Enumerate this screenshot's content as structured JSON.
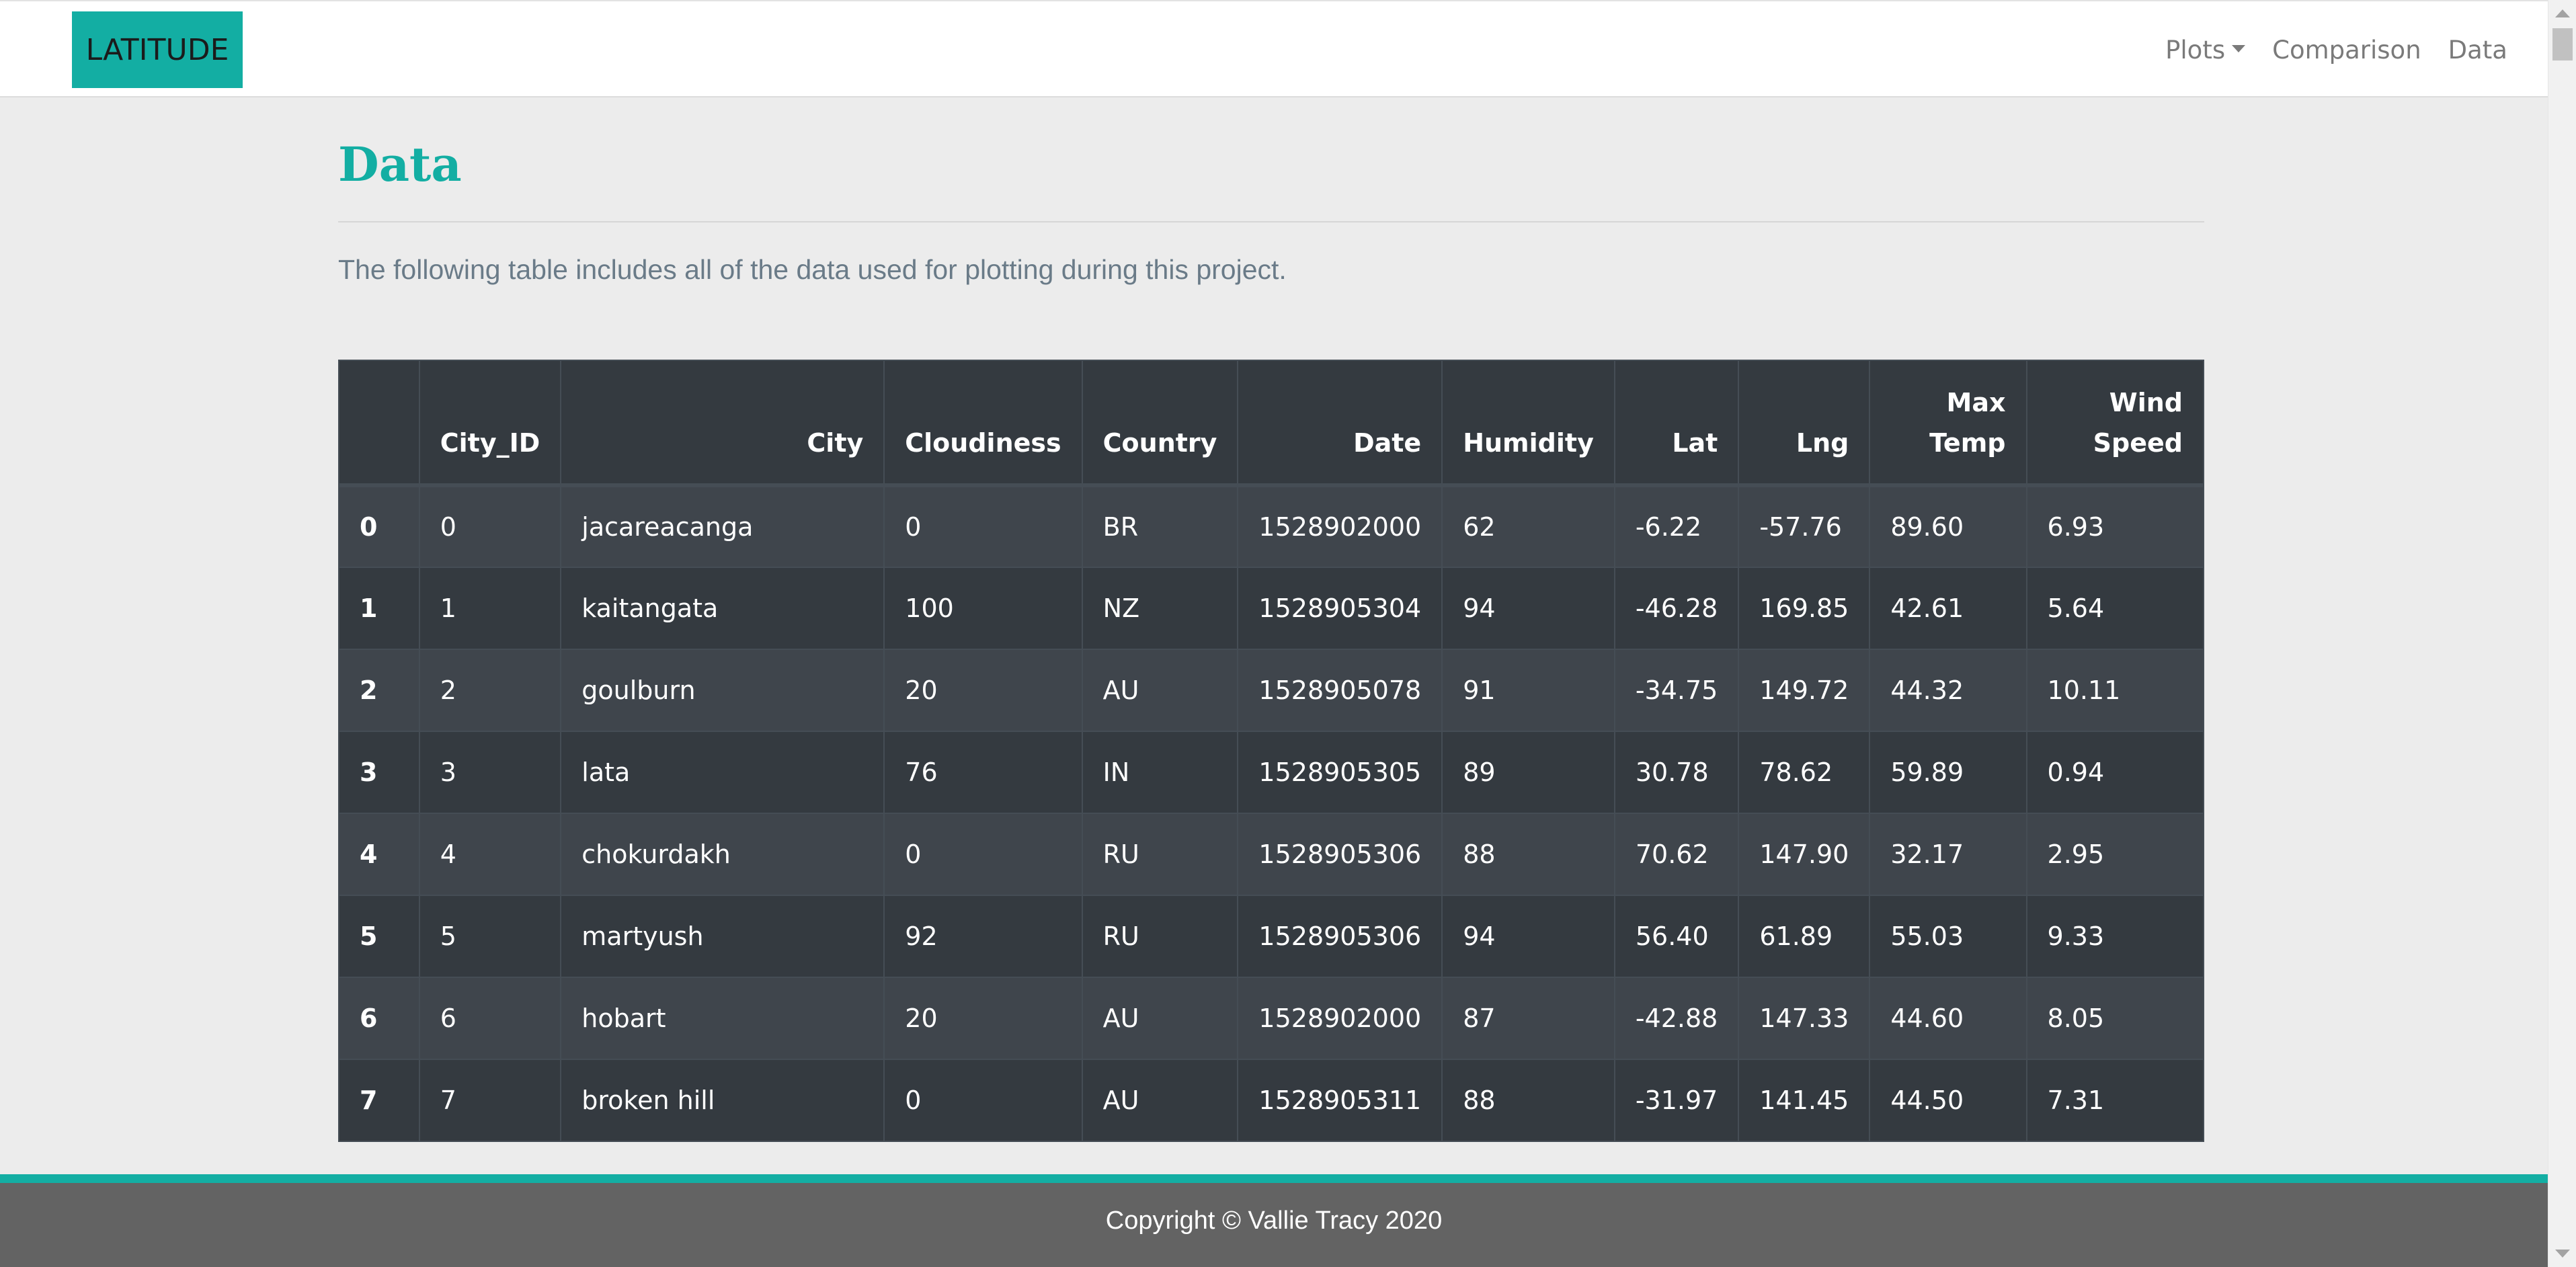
{
  "navbar": {
    "brand": "LATITUDE",
    "links": [
      {
        "label": "Plots",
        "dropdown": true
      },
      {
        "label": "Comparison"
      },
      {
        "label": "Data"
      }
    ]
  },
  "page": {
    "title": "Data",
    "intro": "The following table includes all of the data used for plotting during this project."
  },
  "table": {
    "columns": [
      "",
      "City_ID",
      "City",
      "Cloudiness",
      "Country",
      "Date",
      "Humidity",
      "Lat",
      "Lng",
      "Max Temp",
      "Wind Speed"
    ],
    "rows": [
      [
        "0",
        "0",
        "jacareacanga",
        "0",
        "BR",
        "1528902000",
        "62",
        "-6.22",
        "-57.76",
        "89.60",
        "6.93"
      ],
      [
        "1",
        "1",
        "kaitangata",
        "100",
        "NZ",
        "1528905304",
        "94",
        "-46.28",
        "169.85",
        "42.61",
        "5.64"
      ],
      [
        "2",
        "2",
        "goulburn",
        "20",
        "AU",
        "1528905078",
        "91",
        "-34.75",
        "149.72",
        "44.32",
        "10.11"
      ],
      [
        "3",
        "3",
        "lata",
        "76",
        "IN",
        "1528905305",
        "89",
        "30.78",
        "78.62",
        "59.89",
        "0.94"
      ],
      [
        "4",
        "4",
        "chokurdakh",
        "0",
        "RU",
        "1528905306",
        "88",
        "70.62",
        "147.90",
        "32.17",
        "2.95"
      ],
      [
        "5",
        "5",
        "martyush",
        "92",
        "RU",
        "1528905306",
        "94",
        "56.40",
        "61.89",
        "55.03",
        "9.33"
      ],
      [
        "6",
        "6",
        "hobart",
        "20",
        "AU",
        "1528902000",
        "87",
        "-42.88",
        "147.33",
        "44.60",
        "8.05"
      ],
      [
        "7",
        "7",
        "broken hill",
        "0",
        "AU",
        "1528905311",
        "88",
        "-31.97",
        "141.45",
        "44.50",
        "7.31"
      ]
    ]
  },
  "footer": {
    "text": "Copyright © Vallie Tracy 2020"
  },
  "colors": {
    "accent": "#13aea3",
    "table_dark": "#343a40",
    "table_stripe": "#3f454c",
    "footer_bg": "#636363"
  }
}
